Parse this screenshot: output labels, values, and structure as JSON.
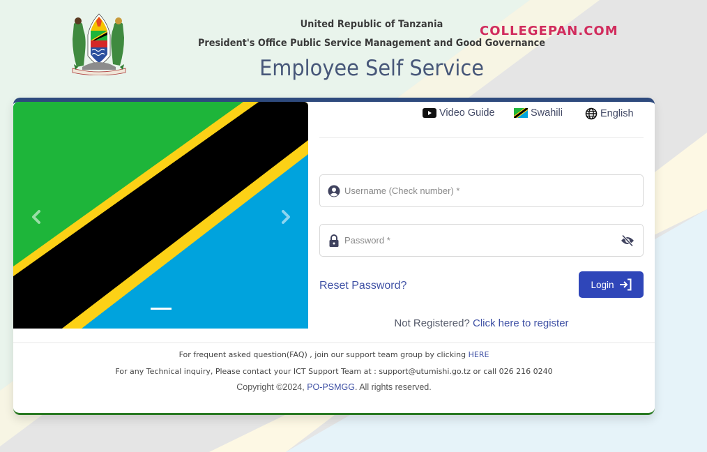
{
  "header": {
    "line1": "United Republic of Tanzania",
    "line2": "President's Office Public Service Management and Good Governance",
    "title": "Employee Self Service",
    "watermark": "COLLEGEPAN.COM"
  },
  "topbar": {
    "video_guide": "Video Guide",
    "swahili": "Swahili",
    "english": "English"
  },
  "carousel": {
    "prev_icon": "chevron-left-icon",
    "next_icon": "chevron-right-icon",
    "slides": 1,
    "active_slide": 1
  },
  "form": {
    "username_placeholder": "Username (Check number) *",
    "username_value": "",
    "password_placeholder": "Password *",
    "password_value": "",
    "reset_label": "Reset Password?",
    "login_label": "Login",
    "register_prefix": "Not Registered?",
    "register_link": "Click here to register"
  },
  "footer": {
    "faq_text": "For frequent asked question(FAQ) , join our support team group by clicking",
    "faq_link": "HERE",
    "support_text": "For any Technical inquiry, Please contact your ICT Support Team at : support@utumishi.go.tz or call 026 216 0240",
    "copyright_prefix": "Copyright ©2024,",
    "copyright_link": "PO-PSMGG",
    "copyright_suffix": ". All rights reserved."
  },
  "colors": {
    "primary": "#2f46b9",
    "link": "#3f51a5",
    "title": "#475779",
    "card_top_border": "#2e4a7d",
    "card_bottom_border": "#2a7a23",
    "flag_green": "#1eb53a",
    "flag_yellow": "#fcd116",
    "flag_black": "#000000",
    "flag_blue": "#00a3dd"
  }
}
